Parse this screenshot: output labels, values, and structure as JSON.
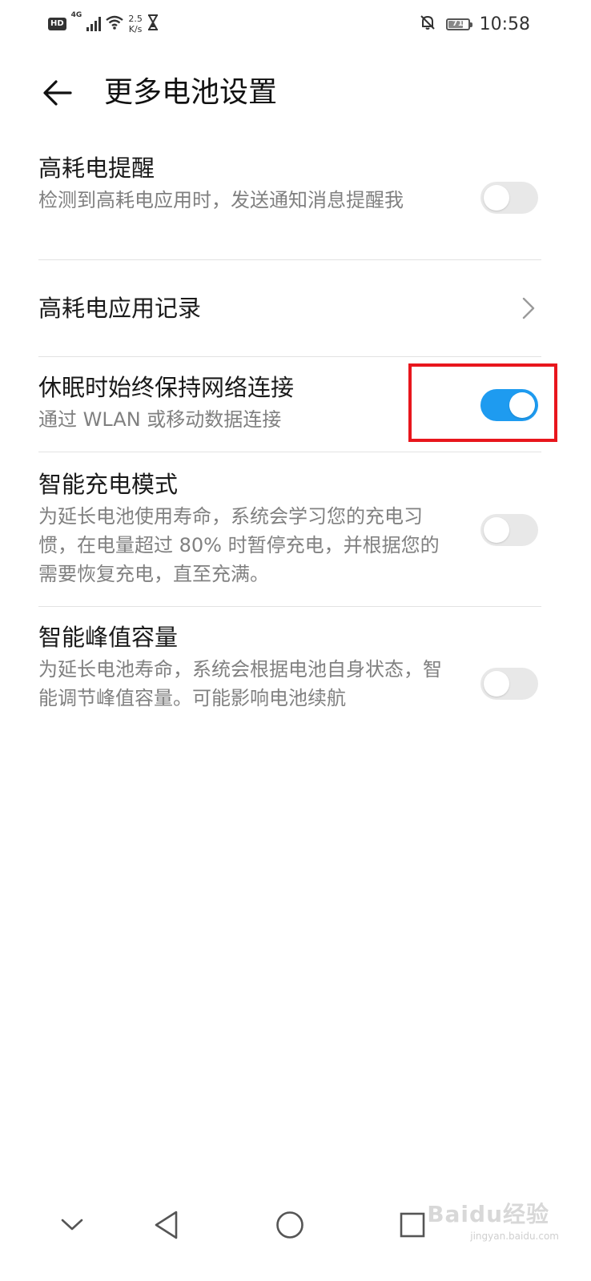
{
  "status_bar": {
    "hd": "HD",
    "network_gen": "4G",
    "speed_value": "2.5",
    "speed_unit": "K/s",
    "battery_level": "71",
    "time": "10:58"
  },
  "header": {
    "title": "更多电池设置"
  },
  "settings": [
    {
      "title": "高耗电提醒",
      "description": "检测到高耗电应用时，发送通知消息提醒我",
      "control": "switch",
      "on": false
    },
    {
      "title": "高耗电应用记录",
      "control": "chevron"
    },
    {
      "title": "休眠时始终保持网络连接",
      "description": "通过 WLAN 或移动数据连接",
      "control": "switch",
      "on": true
    },
    {
      "title": "智能充电模式",
      "description": "为延长电池使用寿命，系统会学习您的充电习惯，在电量超过 80% 时暂停充电，并根据您的需要恢复充电，直至充满。",
      "control": "switch",
      "on": false
    },
    {
      "title": "智能峰值容量",
      "description": "为延长电池寿命，系统会根据电池自身状态，智能调节峰值容量。可能影响电池续航",
      "control": "switch",
      "on": false
    }
  ],
  "colors": {
    "switch_on": "#1e9bf0",
    "switch_off": "#e8e8e8",
    "highlight": "#e8161d"
  },
  "icons": {
    "back": "arrow-left-icon",
    "chevron": "chevron-right-icon",
    "nav_down": "chevron-down-icon",
    "nav_back": "triangle-back-icon",
    "nav_home": "circle-home-icon",
    "nav_recents": "square-recents-icon"
  },
  "watermark": {
    "brand": "Baidu经验",
    "url": "jingyan.baidu.com"
  }
}
